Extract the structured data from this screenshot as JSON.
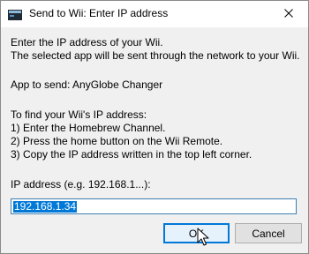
{
  "window": {
    "title": "Send to Wii: Enter IP address",
    "close_icon": "close-icon"
  },
  "body": {
    "intro_line1": "Enter the IP address of your Wii.",
    "intro_line2": "The selected app will be sent through the network to your Wii.",
    "app_line": "App to send: AnyGlobe Changer",
    "instructions_heading": "To find your Wii's IP address:",
    "step1": "1) Enter the Homebrew Channel.",
    "step2": "2) Press the home button on the Wii Remote.",
    "step3": "3) Copy the IP address written in the top left corner."
  },
  "form": {
    "ip_label": "IP address (e.g. 192.168.1...):",
    "ip_value": "192.168.1.34"
  },
  "buttons": {
    "ok_label": "OK",
    "cancel_label": "Cancel"
  },
  "colors": {
    "selection": "#0078d7",
    "focus_border": "#0078d7"
  }
}
